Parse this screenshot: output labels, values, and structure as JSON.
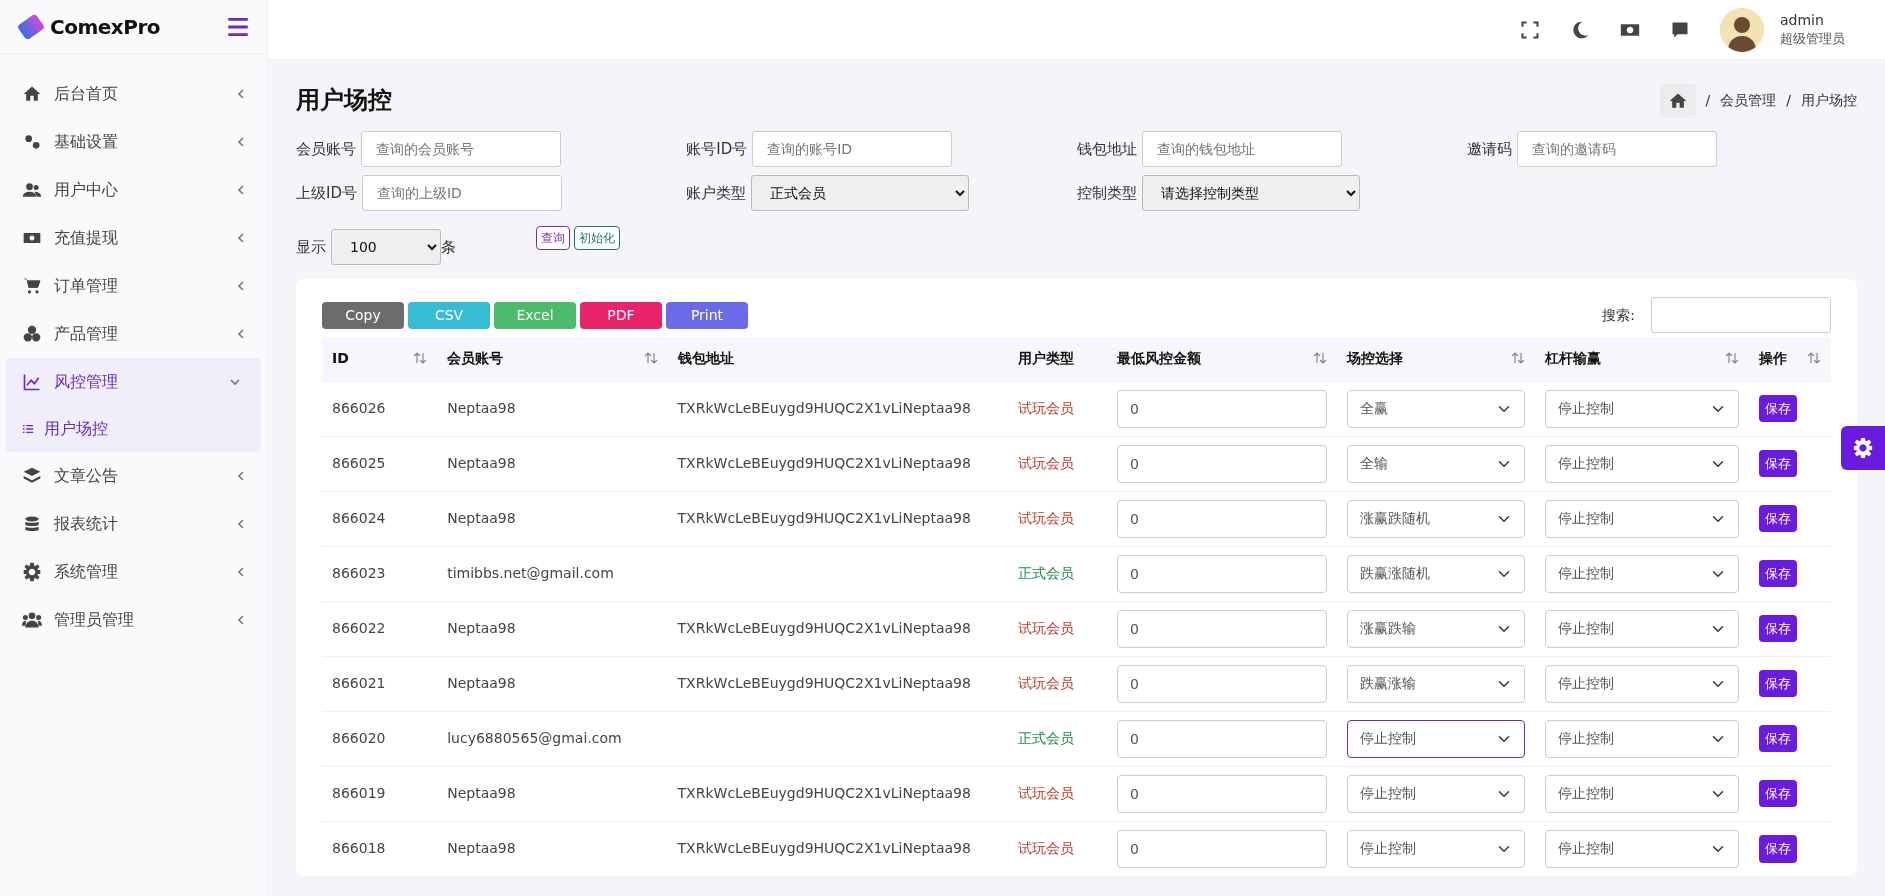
{
  "brand": "ComexPro",
  "sidebar": {
    "items": [
      {
        "label": "后台首页",
        "expanded": false
      },
      {
        "label": "基础设置",
        "expanded": false
      },
      {
        "label": "用户中心",
        "expanded": false
      },
      {
        "label": "充值提现",
        "expanded": false
      },
      {
        "label": "订单管理",
        "expanded": false
      },
      {
        "label": "产品管理",
        "expanded": false
      },
      {
        "label": "风控管理",
        "expanded": true,
        "children": [
          {
            "label": "用户场控",
            "selected": true
          }
        ]
      },
      {
        "label": "文章公告",
        "expanded": false
      },
      {
        "label": "报表统计",
        "expanded": false
      },
      {
        "label": "系统管理",
        "expanded": false
      },
      {
        "label": "管理员管理",
        "expanded": false
      }
    ]
  },
  "user": {
    "name": "admin",
    "role": "超级管理员"
  },
  "page_title": "用户场控",
  "breadcrumb": [
    {
      "separator": "/",
      "label": "会员管理"
    },
    {
      "separator": "/",
      "label": "用户场控"
    }
  ],
  "filters": [
    {
      "kind": "input",
      "label": "会员账号",
      "placeholder": "查询的会员账号"
    },
    {
      "kind": "input",
      "label": "账号ID号",
      "placeholder": "查询的账号ID"
    },
    {
      "kind": "input",
      "label": "钱包地址",
      "placeholder": "查询的钱包地址"
    },
    {
      "kind": "input",
      "label": "邀请码",
      "placeholder": "查询的邀请码"
    },
    {
      "kind": "input",
      "label": "上级ID号",
      "placeholder": "查询的上级ID"
    },
    {
      "kind": "select",
      "label": "账户类型",
      "value": "正式会员"
    },
    {
      "kind": "select",
      "label": "控制类型",
      "value": "请选择控制类型"
    }
  ],
  "page_size": {
    "label": "显示",
    "value": "100",
    "unit": "条"
  },
  "actions": [
    "查询",
    "初始化"
  ],
  "export_buttons": [
    "Copy",
    "CSV",
    "Excel",
    "PDF",
    "Print"
  ],
  "search_label": "搜索:",
  "table": {
    "columns": [
      {
        "label": "ID",
        "sortable": true
      },
      {
        "label": "会员账号",
        "sortable": true
      },
      {
        "label": "钱包地址",
        "sortable": false
      },
      {
        "label": "用户类型",
        "sortable": false
      },
      {
        "label": "最低风控金额",
        "sortable": true
      },
      {
        "label": "场控选择",
        "sortable": true
      },
      {
        "label": "杠杆输赢",
        "sortable": true
      },
      {
        "label": "操作",
        "sortable": true
      }
    ],
    "rows": [
      {
        "id": "866026",
        "account": "Neptaa98",
        "wallet": "TXRkWcLeBEuygd9HUQC2X1vLiNeptaa98",
        "user_type": "试玩会员",
        "color": "#c0392b",
        "min_amount": "0",
        "scene": "全赢",
        "scene_focused": false,
        "leverage": "停止控制",
        "action": "保存"
      },
      {
        "id": "866025",
        "account": "Neptaa98",
        "wallet": "TXRkWcLeBEuygd9HUQC2X1vLiNeptaa98",
        "user_type": "试玩会员",
        "color": "#c0392b",
        "min_amount": "0",
        "scene": "全输",
        "scene_focused": false,
        "leverage": "停止控制",
        "action": "保存"
      },
      {
        "id": "866024",
        "account": "Neptaa98",
        "wallet": "TXRkWcLeBEuygd9HUQC2X1vLiNeptaa98",
        "user_type": "试玩会员",
        "color": "#c0392b",
        "min_amount": "0",
        "scene": "涨赢跌随机",
        "scene_focused": false,
        "leverage": "停止控制",
        "action": "保存"
      },
      {
        "id": "866023",
        "account": "timibbs.net@gmail.com",
        "user_type": "正式会员",
        "color": "#1e8a4c",
        "min_amount": "0",
        "scene": "跌赢涨随机",
        "scene_focused": false,
        "leverage": "停止控制",
        "action": "保存"
      },
      {
        "id": "866022",
        "account": "Neptaa98",
        "wallet": "TXRkWcLeBEuygd9HUQC2X1vLiNeptaa98",
        "user_type": "试玩会员",
        "color": "#c0392b",
        "min_amount": "0",
        "scene": "涨赢跌输",
        "scene_focused": false,
        "leverage": "停止控制",
        "action": "保存"
      },
      {
        "id": "866021",
        "account": "Neptaa98",
        "wallet": "TXRkWcLeBEuygd9HUQC2X1vLiNeptaa98",
        "user_type": "试玩会员",
        "color": "#c0392b",
        "min_amount": "0",
        "scene": "跌赢涨输",
        "scene_focused": false,
        "leverage": "停止控制",
        "action": "保存"
      },
      {
        "id": "866020",
        "account": "lucy6880565@gmai.com",
        "user_type": "正式会员",
        "color": "#1e8a4c",
        "min_amount": "0",
        "scene": "停止控制",
        "scene_focused": true,
        "leverage": "停止控制",
        "action": "保存"
      },
      {
        "id": "866019",
        "account": "Neptaa98",
        "wallet": "TXRkWcLeBEuygd9HUQC2X1vLiNeptaa98",
        "user_type": "试玩会员",
        "color": "#c0392b",
        "min_amount": "0",
        "scene": "停止控制",
        "scene_focused": false,
        "leverage": "停止控制",
        "action": "保存"
      },
      {
        "id": "866018",
        "account": "Neptaa98",
        "wallet": "TXRkWcLeBEuygd9HUQC2X1vLiNeptaa98",
        "user_type": "试玩会员",
        "color": "#c0392b",
        "min_amount": "0",
        "scene": "停止控制",
        "scene_focused": false,
        "leverage": "停止控制",
        "action": "保存"
      }
    ]
  }
}
